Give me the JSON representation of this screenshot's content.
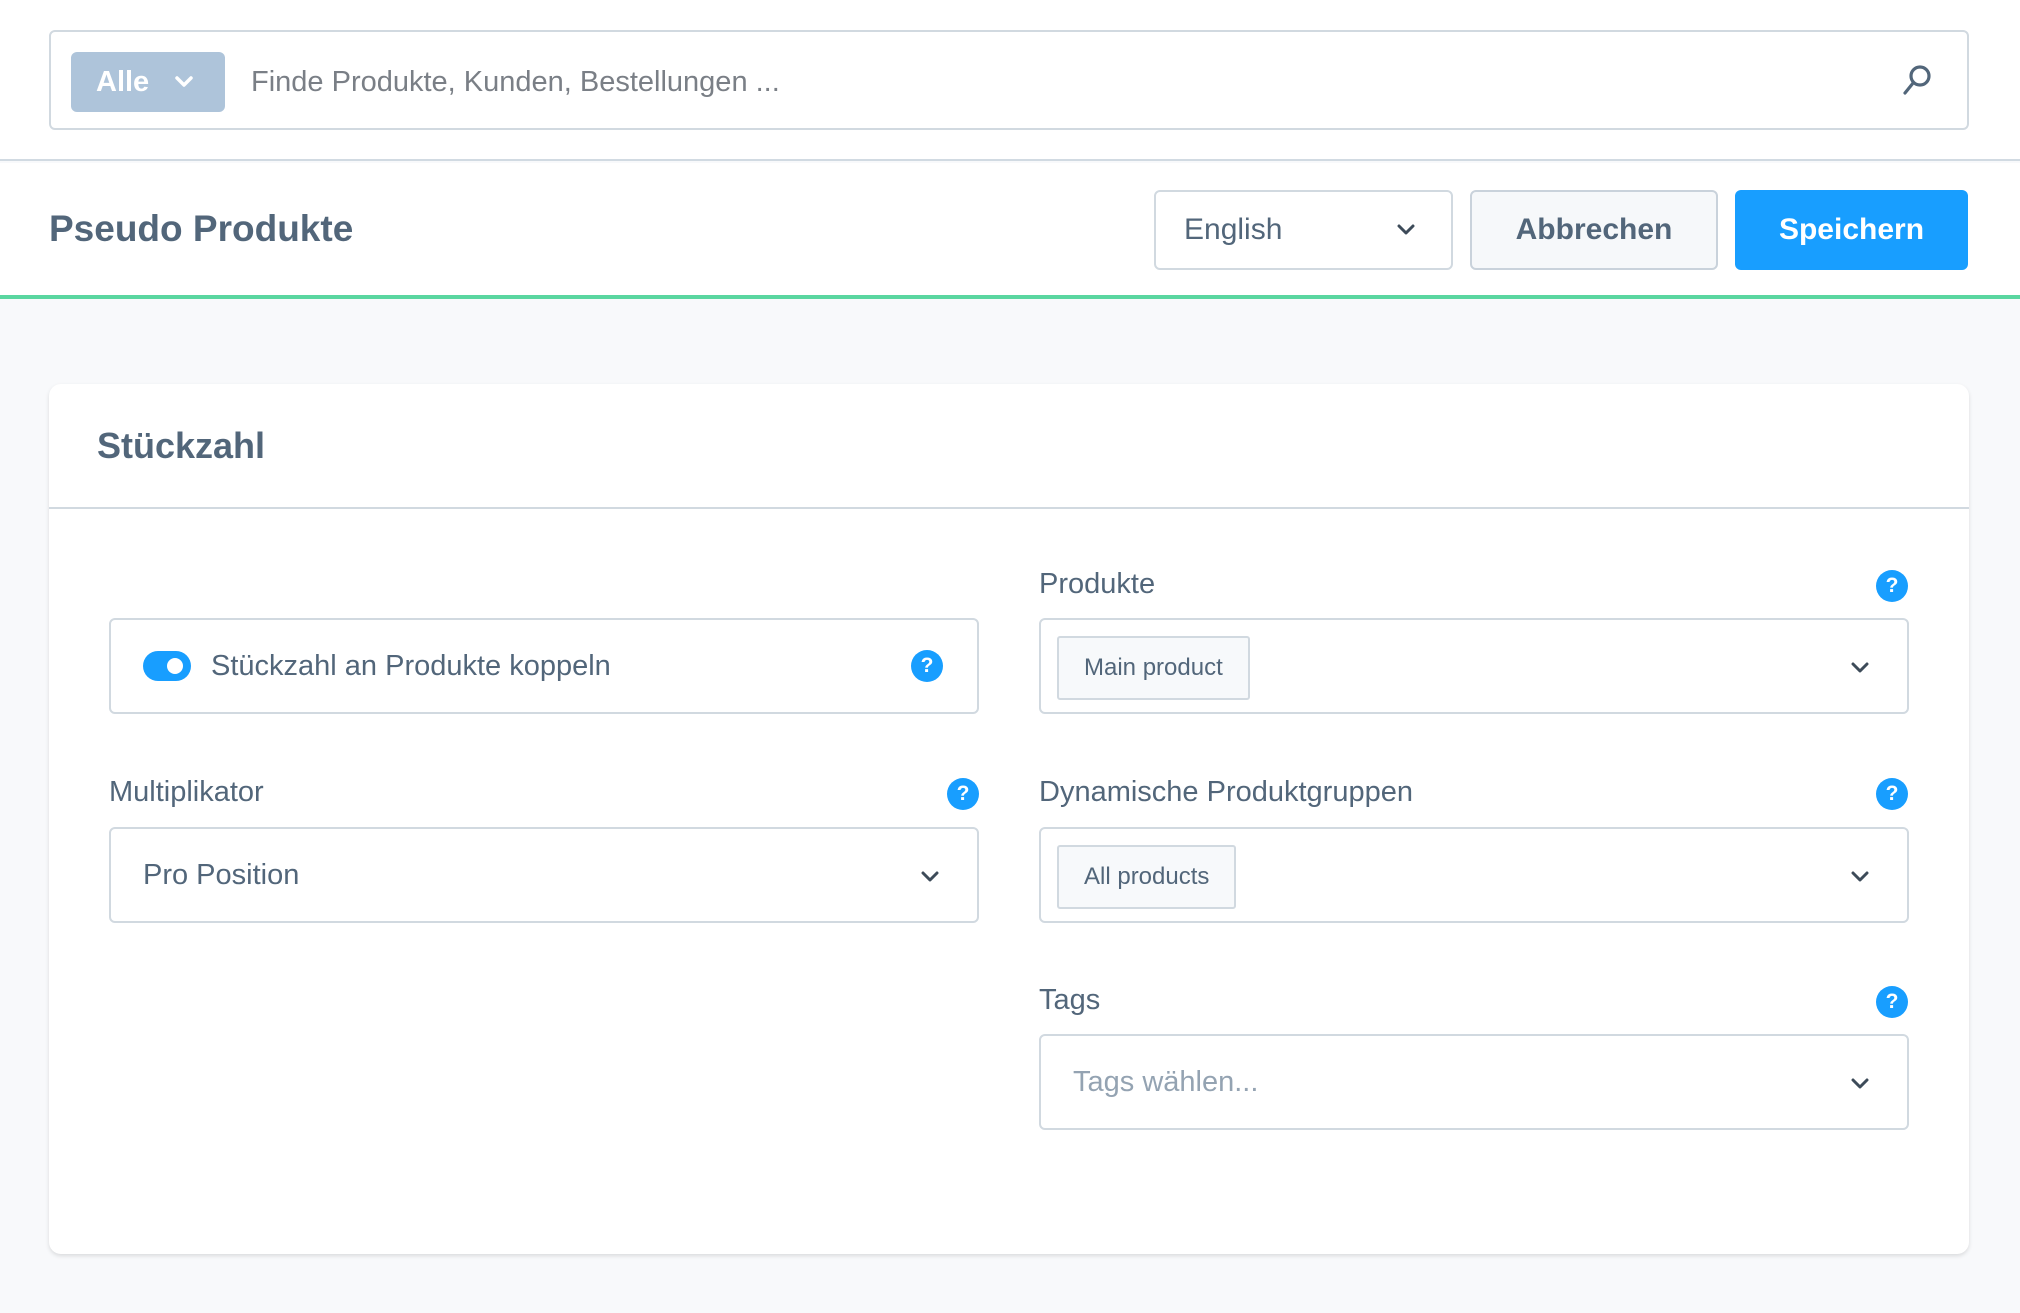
{
  "search": {
    "scope_label": "Alle",
    "placeholder": "Finde Produkte, Kunden, Bestellungen ...",
    "value": ""
  },
  "header": {
    "title": "Pseudo Produkte",
    "language": "English",
    "cancel_label": "Abbrechen",
    "save_label": "Speichern"
  },
  "card": {
    "title": "Stückzahl",
    "toggle": {
      "label": "Stückzahl an Produkte koppeln",
      "checked": true
    },
    "multiplier": {
      "label": "Multiplikator",
      "value": "Pro Position"
    },
    "products": {
      "label": "Produkte",
      "tags": [
        "Main product"
      ]
    },
    "dynamic_groups": {
      "label": "Dynamische Produktgruppen",
      "tags": [
        "All products"
      ]
    },
    "tags": {
      "label": "Tags",
      "placeholder": "Tags wählen..."
    },
    "help_glyph": "?"
  },
  "colors": {
    "primary": "#189eff",
    "success_line": "#5ad6a0",
    "scope_button": "#aec4da",
    "text": "#52667a"
  }
}
